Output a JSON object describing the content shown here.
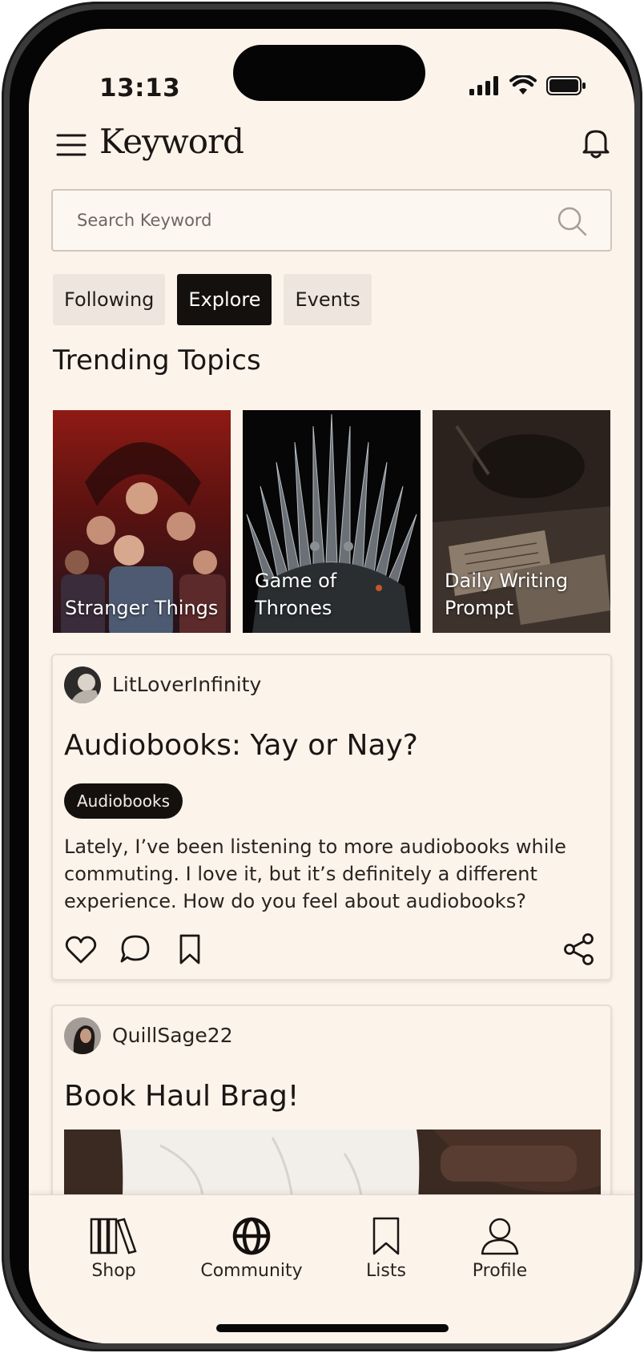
{
  "status_bar": {
    "time": "13:13"
  },
  "header": {
    "brand": "Keyword"
  },
  "search": {
    "placeholder": "Search Keyword"
  },
  "tabs": [
    {
      "label": "Following",
      "active": false
    },
    {
      "label": "Explore",
      "active": true
    },
    {
      "label": "Events",
      "active": false
    }
  ],
  "trending": {
    "title": "Trending Topics",
    "topics": [
      {
        "label": "Stranger Things"
      },
      {
        "label": "Game of Thrones"
      },
      {
        "label": "Daily Writing Prompt"
      }
    ]
  },
  "posts": [
    {
      "username": "LitLoverInfinity",
      "title": "Audiobooks: Yay or Nay?",
      "tag": "Audiobooks",
      "body": "Lately, I’ve been listening to more audiobooks while commuting. I love it, but it’s definitely a different experience. How do you feel about audiobooks?"
    },
    {
      "username": "QuillSage22",
      "title": "Book Haul Brag!"
    }
  ],
  "bottom_nav": [
    {
      "label": "Shop",
      "icon": "books-icon"
    },
    {
      "label": "Community",
      "icon": "globe-icon",
      "active": true
    },
    {
      "label": "Lists",
      "icon": "bookmark-icon"
    },
    {
      "label": "Profile",
      "icon": "person-icon"
    }
  ],
  "colors": {
    "background": "#fcf3eb",
    "accent": "#14100e",
    "chip": "#eee5de"
  }
}
